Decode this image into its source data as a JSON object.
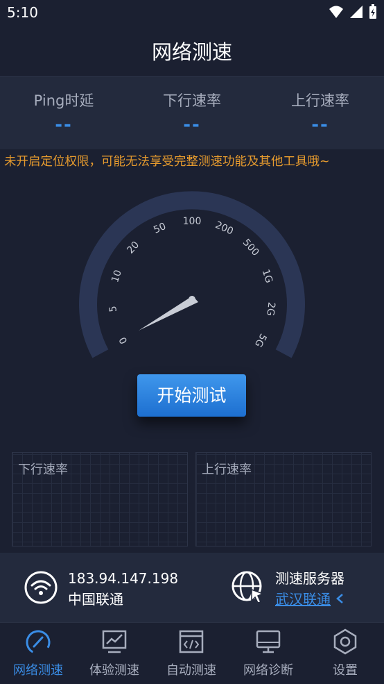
{
  "status_bar": {
    "time": "5:10"
  },
  "app": {
    "title": "网络测速"
  },
  "stats": [
    {
      "label": "Ping时延",
      "value": "--"
    },
    {
      "label": "下行速率",
      "value": "--"
    },
    {
      "label": "上行速率",
      "value": "--"
    }
  ],
  "warning": "未开启定位权限，可能无法享受完整测速功能及其他工具哦~",
  "gauge": {
    "ticks": [
      "0",
      "5",
      "10",
      "20",
      "50",
      "100",
      "200",
      "500",
      "1G",
      "2G",
      "5G"
    ],
    "needle_level": 0
  },
  "start_button": "开始测试",
  "charts": {
    "download_label": "下行速率",
    "upload_label": "上行速率"
  },
  "network": {
    "ip": "183.94.147.198",
    "carrier": "中国联通"
  },
  "server": {
    "label": "测速服务器",
    "name": "武汉联通"
  },
  "nav": [
    {
      "label": "网络测速",
      "icon": "speedometer-icon",
      "active": true
    },
    {
      "label": "体验测速",
      "icon": "trend-chart-icon",
      "active": false
    },
    {
      "label": "自动测速",
      "icon": "code-window-icon",
      "active": false
    },
    {
      "label": "网络诊断",
      "icon": "monitor-icon",
      "active": false
    },
    {
      "label": "设置",
      "icon": "hexagon-settings-icon",
      "active": false
    }
  ],
  "colors": {
    "background": "#1b2031",
    "panel": "#232a3d",
    "accent": "#3a8de6",
    "warning": "#e59a2e",
    "gauge_track": "#2b3655"
  }
}
